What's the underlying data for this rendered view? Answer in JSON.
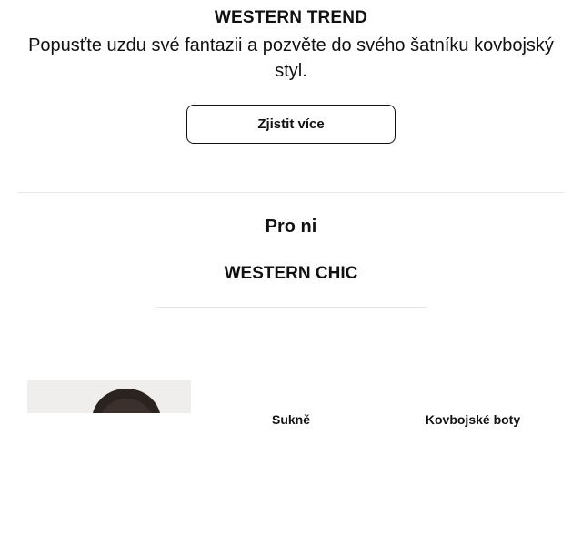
{
  "hero": {
    "title": "WESTERN TREND",
    "description": "Popusťte uzdu své fantazii a pozvěte do svého šatníku kovbojský styl.",
    "cta_label": "Zjistit více"
  },
  "section": {
    "title": "Pro ni",
    "subtitle": "WESTERN CHIC"
  },
  "products": [
    {
      "label": ""
    },
    {
      "label": "Sukně"
    },
    {
      "label": "Kovbojské boty"
    }
  ]
}
